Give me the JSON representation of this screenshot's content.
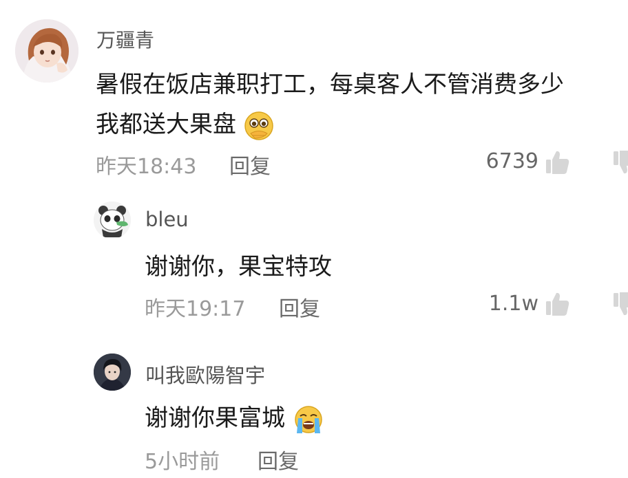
{
  "comments": [
    {
      "username": "万疆青",
      "text_line1": "暑假在饭店兼职打工，每桌客人不管消费多少",
      "text_line2": "我都送大果盘",
      "emoji": "pleading-face",
      "time": "昨天18:43",
      "reply_label": "回复",
      "likes": "6739"
    },
    {
      "username": "bleu",
      "text": "谢谢你，果宝特攻",
      "time": "昨天19:17",
      "reply_label": "回复",
      "likes": "1.1w"
    },
    {
      "username": "叫我歐陽智宇",
      "text": "谢谢你果富城",
      "emoji": "loudly-crying-face",
      "time": "5小时前",
      "reply_label": "回复"
    }
  ],
  "colors": {
    "username": "#555555",
    "text": "#1a1a1a",
    "meta": "#9a9a9a",
    "like_icon": "#d0d0d0"
  }
}
